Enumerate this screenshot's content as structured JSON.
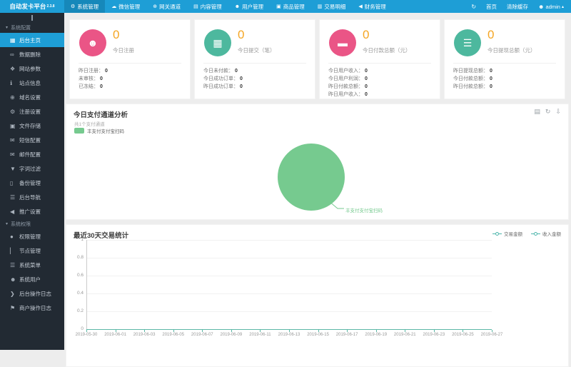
{
  "colors": {
    "navbar": "#1e9ed6",
    "navbar_active": "#1688ba",
    "sidebar": "#222a33",
    "accent_blue": "#1e9ed6",
    "number_orange": "#f5a623",
    "pink": "#ea5586",
    "teal_green": "#4db89e",
    "pie_green": "#76ca8f",
    "line_teal": "#4db6ac",
    "axis_teal": "#5cb8a6"
  },
  "header": {
    "brand": "自动发卡平台",
    "version": "2.3.8",
    "menu": [
      {
        "name": "system-management",
        "label": "系统管理",
        "icon": "gear-icon",
        "active": true
      },
      {
        "name": "wechat-management",
        "label": "微信管理",
        "icon": "cloud-icon",
        "active": false
      },
      {
        "name": "gateway-channel",
        "label": "网关通道",
        "icon": "gateway-icon",
        "active": false
      },
      {
        "name": "content-management",
        "label": "内容管理",
        "icon": "document-icon",
        "active": false
      },
      {
        "name": "user-management",
        "label": "用户管理",
        "icon": "users-icon",
        "active": false
      },
      {
        "name": "goods-management",
        "label": "商品管理",
        "icon": "cart-icon",
        "active": false
      },
      {
        "name": "transaction-detail",
        "label": "交易明细",
        "icon": "chart-icon",
        "active": false
      },
      {
        "name": "finance-management",
        "label": "财务管理",
        "icon": "finance-icon",
        "active": false
      }
    ],
    "right": {
      "home": "首页",
      "clear_cache": "清除缓存",
      "user": "admin"
    }
  },
  "sidebar": {
    "sections": [
      {
        "title": "系统配置",
        "name": "system-config",
        "items": [
          {
            "name": "backend-home",
            "label": "后台主页",
            "icon": "dashboard-icon",
            "active": true
          },
          {
            "name": "data-delete",
            "label": "数据删除",
            "icon": "link-icon",
            "active": false
          },
          {
            "name": "site-params",
            "label": "网站参数",
            "icon": "params-icon",
            "active": false
          },
          {
            "name": "site-info",
            "label": "站点信息",
            "icon": "info-icon",
            "active": false
          },
          {
            "name": "domain-setting",
            "label": "域名设置",
            "icon": "globe-icon",
            "active": false
          },
          {
            "name": "register-setting",
            "label": "注册设置",
            "icon": "gear-icon",
            "active": false
          },
          {
            "name": "file-storage",
            "label": "文件存储",
            "icon": "save-icon",
            "active": false
          },
          {
            "name": "sms-config",
            "label": "短信配置",
            "icon": "mail-icon",
            "active": false
          },
          {
            "name": "mail-config",
            "label": "邮件配置",
            "icon": "mail-icon",
            "active": false
          },
          {
            "name": "word-filter",
            "label": "字词过滤",
            "icon": "filter-icon",
            "active": false
          },
          {
            "name": "backup-manage",
            "label": "备份管理",
            "icon": "backup-icon",
            "active": false
          },
          {
            "name": "backend-nav",
            "label": "后台导航",
            "icon": "list-icon",
            "active": false
          },
          {
            "name": "promo-setting",
            "label": "推广设置",
            "icon": "bullhorn-icon",
            "active": false
          }
        ]
      },
      {
        "title": "系统权限",
        "name": "system-permission",
        "items": [
          {
            "name": "permission-manage",
            "label": "权限管理",
            "icon": "lock-icon",
            "active": false
          },
          {
            "name": "node-manage",
            "label": "节点管理",
            "icon": "node-icon",
            "active": false
          },
          {
            "name": "system-menu",
            "label": "系统菜单",
            "icon": "menu-icon",
            "active": false
          },
          {
            "name": "system-users",
            "label": "系统用户",
            "icon": "users-icon",
            "active": false
          },
          {
            "name": "admin-op-log",
            "label": "后台操作日志",
            "icon": "terminal-icon",
            "active": false
          },
          {
            "name": "merchant-op-log",
            "label": "商户操作日志",
            "icon": "flag-icon",
            "active": false
          }
        ]
      }
    ]
  },
  "cards": [
    {
      "name": "today-register",
      "value": "0",
      "label": "今日注册",
      "icon": "users-icon",
      "circle_color": "#ea5586",
      "rows": [
        {
          "label": "昨日注册：",
          "value": "0"
        },
        {
          "label": "未审核：",
          "value": "0"
        },
        {
          "label": "已冻结：",
          "value": "0"
        }
      ]
    },
    {
      "name": "today-submit",
      "value": "0",
      "label": "今日提交（笔）",
      "icon": "calendar-icon",
      "circle_color": "#4db89e",
      "rows": [
        {
          "label": "今日未付款：",
          "value": "0"
        },
        {
          "label": "今日成功订单：",
          "value": "0"
        },
        {
          "label": "昨日成功订单：",
          "value": "0"
        }
      ]
    },
    {
      "name": "today-payment-total",
      "value": "0",
      "label": "今日付款总额（元）",
      "icon": "card-icon",
      "circle_color": "#ea5586",
      "rows": [
        {
          "label": "今日用户收入：",
          "value": "0"
        },
        {
          "label": "今日用户利润：",
          "value": "0"
        },
        {
          "label": "昨日付款总额：",
          "value": "0"
        },
        {
          "label": "昨日用户收入：",
          "value": "0"
        }
      ]
    },
    {
      "name": "today-withdraw-total",
      "value": "0",
      "label": "今日提现总额（元）",
      "icon": "coins-icon",
      "circle_color": "#4db89e",
      "rows": [
        {
          "label": "昨日提现总额：",
          "value": "0"
        },
        {
          "label": "今日付款总额：",
          "value": "0"
        },
        {
          "label": "昨日付款总额：",
          "value": "0"
        }
      ]
    }
  ],
  "pie_panel": {
    "title": "今日支付通道分析",
    "subtitle": "共1个支付通道",
    "legend": "丰支付支付宝扫码",
    "slice_label": "丰支付支付宝扫码",
    "toolbox": [
      "data-view-icon",
      "refresh-icon",
      "download-icon"
    ]
  },
  "line_panel": {
    "title": "最近30天交易统计",
    "legend": [
      "交易金额",
      "收入金额"
    ],
    "y_ticks": [
      "1",
      "0.8",
      "0.6",
      "0.4",
      "0.2",
      "0"
    ],
    "x_ticks": [
      "2019-05-30",
      "2019-06-01",
      "2019-06-03",
      "2019-06-05",
      "2019-06-07",
      "2019-06-09",
      "2019-06-11",
      "2019-06-13",
      "2019-06-15",
      "2019-06-17",
      "2019-06-19",
      "2019-06-21",
      "2019-06-23",
      "2019-06-25",
      "2019-06-27"
    ]
  },
  "chart_data": [
    {
      "type": "pie",
      "title": "今日支付通道分析",
      "slices": [
        {
          "label": "丰支付支付宝扫码",
          "value": 1
        }
      ],
      "colors": [
        "#76ca8f"
      ],
      "legend_position": "top-left"
    },
    {
      "type": "line",
      "title": "最近30天交易统计",
      "x": [
        "2019-05-30",
        "2019-06-01",
        "2019-06-03",
        "2019-06-05",
        "2019-06-07",
        "2019-06-09",
        "2019-06-11",
        "2019-06-13",
        "2019-06-15",
        "2019-06-17",
        "2019-06-19",
        "2019-06-21",
        "2019-06-23",
        "2019-06-25",
        "2019-06-27"
      ],
      "series": [
        {
          "name": "交易金额",
          "values": [
            0,
            0,
            0,
            0,
            0,
            0,
            0,
            0,
            0,
            0,
            0,
            0,
            0,
            0,
            0
          ]
        },
        {
          "name": "收入金额",
          "values": [
            0,
            0,
            0,
            0,
            0,
            0,
            0,
            0,
            0,
            0,
            0,
            0,
            0,
            0,
            0
          ]
        }
      ],
      "ylim": [
        0,
        1
      ],
      "yticks": [
        0,
        0.2,
        0.4,
        0.6,
        0.8,
        1
      ],
      "grid": true,
      "legend_position": "top-right"
    }
  ]
}
